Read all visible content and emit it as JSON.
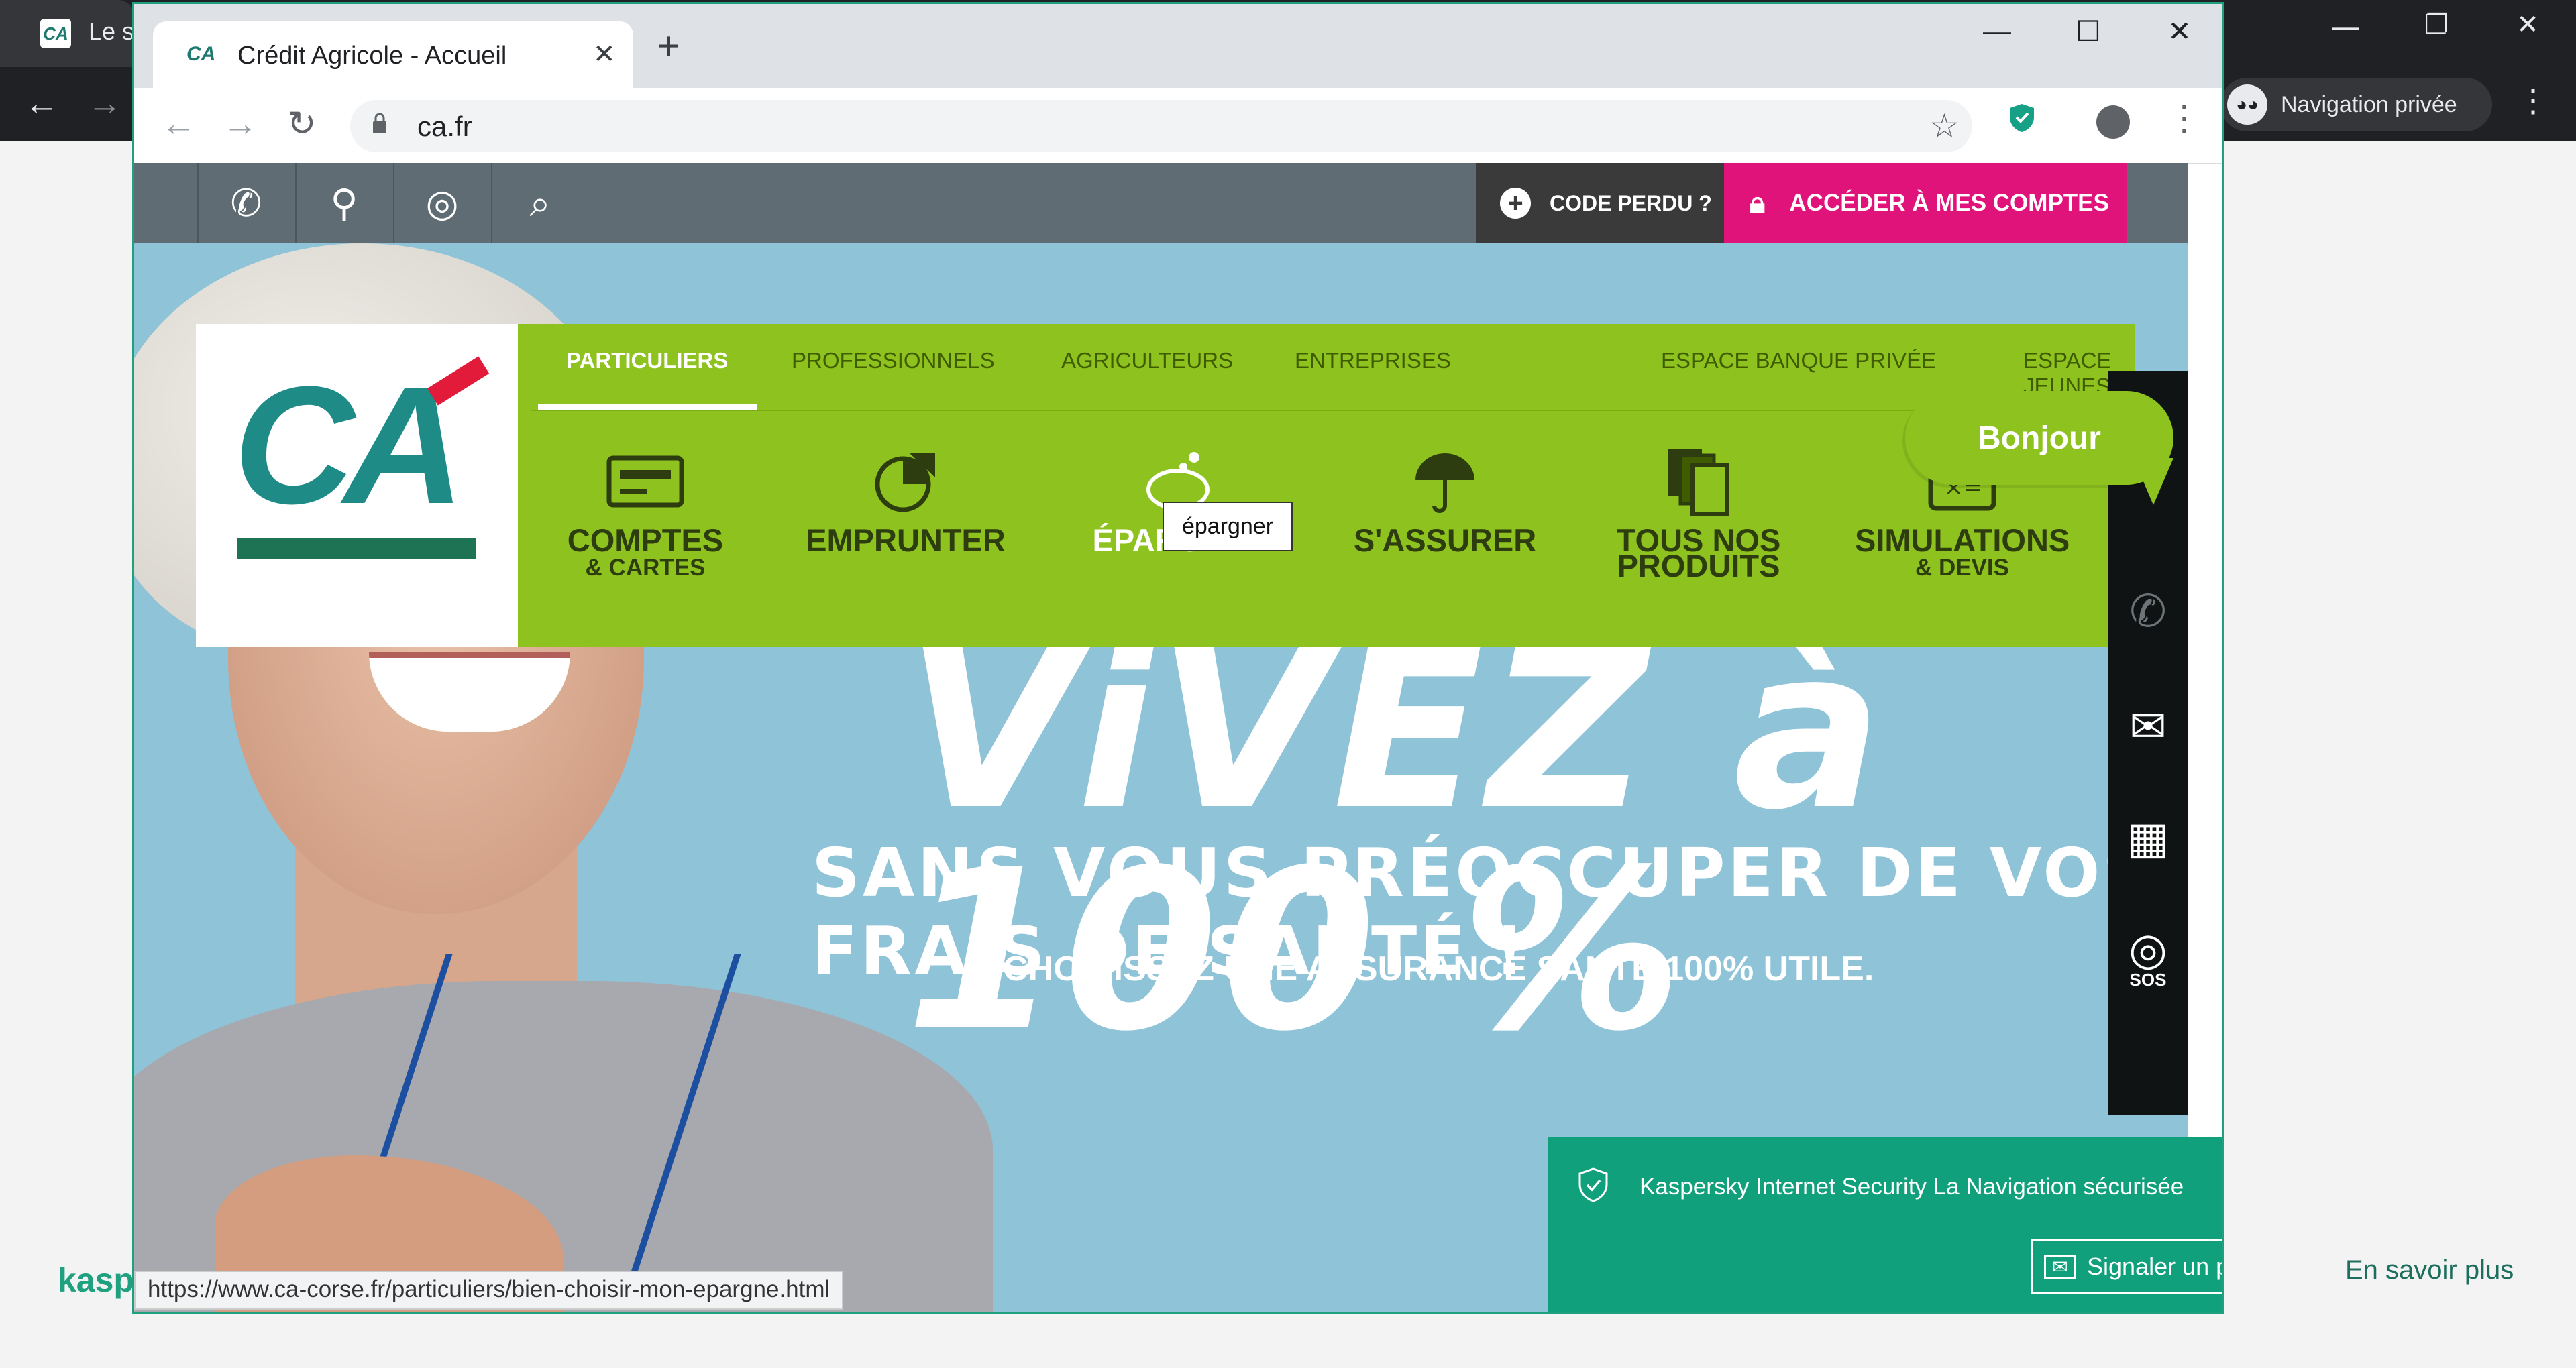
{
  "background_window": {
    "tab_title": "Le s",
    "private_label": "Navigation privée",
    "kaspersky_partial": "kasp",
    "learn_more": "En savoir plus"
  },
  "window": {
    "tab_title": "Crédit Agricole - Accueil",
    "url": "ca.fr",
    "new_tab": "+",
    "minimize": "—",
    "maximize": "☐",
    "close": "✕"
  },
  "page": {
    "code_perdu": "CODE PERDU ?",
    "acceder": "ACCÉDER À MES COMPTES",
    "categories": [
      "PARTICULIERS",
      "PROFESSIONNELS",
      "AGRICULTEURS",
      "ENTREPRISES",
      "ESPACE BANQUE PRIVÉE",
      "ESPACE JEUNES"
    ],
    "active_category": "PARTICULIERS",
    "menu_items": [
      {
        "label": "COMPTES",
        "sub": "& CARTES",
        "icon": "card-icon"
      },
      {
        "label": "EMPRUNTER",
        "sub": "",
        "icon": "pie-chart-icon"
      },
      {
        "label": "ÉPARGNER",
        "sub": "",
        "icon": "piggy-bank-icon"
      },
      {
        "label": "S'ASSURER",
        "sub": "",
        "icon": "umbrella-icon"
      },
      {
        "label": "TOUS NOS",
        "sub": "PRODUITS",
        "icon": "documents-icon"
      },
      {
        "label": "SIMULATIONS",
        "sub": "& DEVIS",
        "icon": "calculator-icon"
      }
    ],
    "tooltip": "épargner",
    "bonjour": "Bonjour",
    "slogan_line1": "ViVEZ à 100 %",
    "slogan_line2": "SANS VOUS PRÉOCCUPER DE VOS FRAIS DE SANTÉ !",
    "slogan_line3": "CHOISISSEZ UNE ASSURANCE SANTÉ 100% UTILE.",
    "rail_sos": "SOS",
    "status_url": "https://www.ca-corse.fr/particuliers/bien-choisir-mon-epargne.html"
  },
  "kaspersky": {
    "message": "Kaspersky Internet Security La Navigation sécurisée",
    "report_button": "Signaler un problème"
  },
  "colors": {
    "menu_green": "#8dc21f",
    "pink": "#e0137a",
    "kaspersky_green": "#10a07c",
    "ca_teal": "#1e8b86",
    "ca_red": "#e31b3a"
  }
}
